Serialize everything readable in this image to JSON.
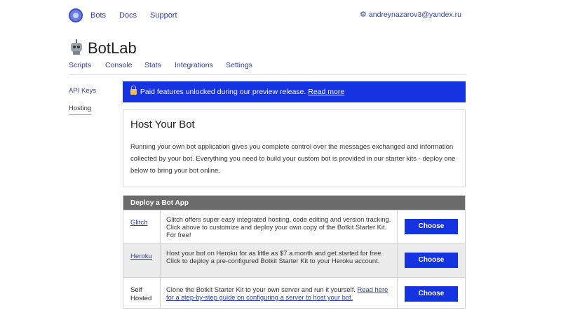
{
  "topnav": {
    "logo_icon": "botkit-logo-icon",
    "links": {
      "bots": "Bots",
      "docs": "Docs",
      "support": "Support"
    },
    "user_email": "andreynazarov3@yandex.ru",
    "user_icon": "gear-icon"
  },
  "header": {
    "app_icon": "robot-icon",
    "title": "BotLab",
    "tabs": {
      "scripts": "Scripts",
      "console": "Console",
      "stats": "Stats",
      "integrations": "Integrations",
      "settings": "Settings"
    }
  },
  "sidebar": {
    "items": [
      "API Keys",
      "Hosting"
    ],
    "selected": "Hosting"
  },
  "banner": {
    "icon": "lock-icon",
    "text": "Paid features unlocked during our preview release.",
    "link": "Read more",
    "color": "#1533e0"
  },
  "host": {
    "title": "Host Your Bot",
    "body": "Running your own bot application gives you complete control over the messages exchanged and information collected by your bot. Everything you need to build your custom bot is provided in our starter kits - deploy one below to bring your bot online."
  },
  "deploy": {
    "heading": "Deploy a Bot App",
    "button_label": "Choose",
    "rows": [
      {
        "name": "Glitch",
        "description": "Glitch offers super easy integrated hosting, code editing and version tracking. Click above to customize and deploy your own copy of the Botkit Starter Kit. For free!"
      },
      {
        "name": "Heroku",
        "description": "Host your bot on Heroku for as little as $7 a month and get started for free. Click to deploy a pre-configured Botkit Starter Kit to your Heroku account."
      },
      {
        "name_line1": "Self",
        "name_line2": "Hosted",
        "description": "Clone the Botkit Starter Kit to your own server and run it yourself.",
        "link": "Read here for a step-by-step guide on configuring a server to host your bot."
      }
    ]
  }
}
